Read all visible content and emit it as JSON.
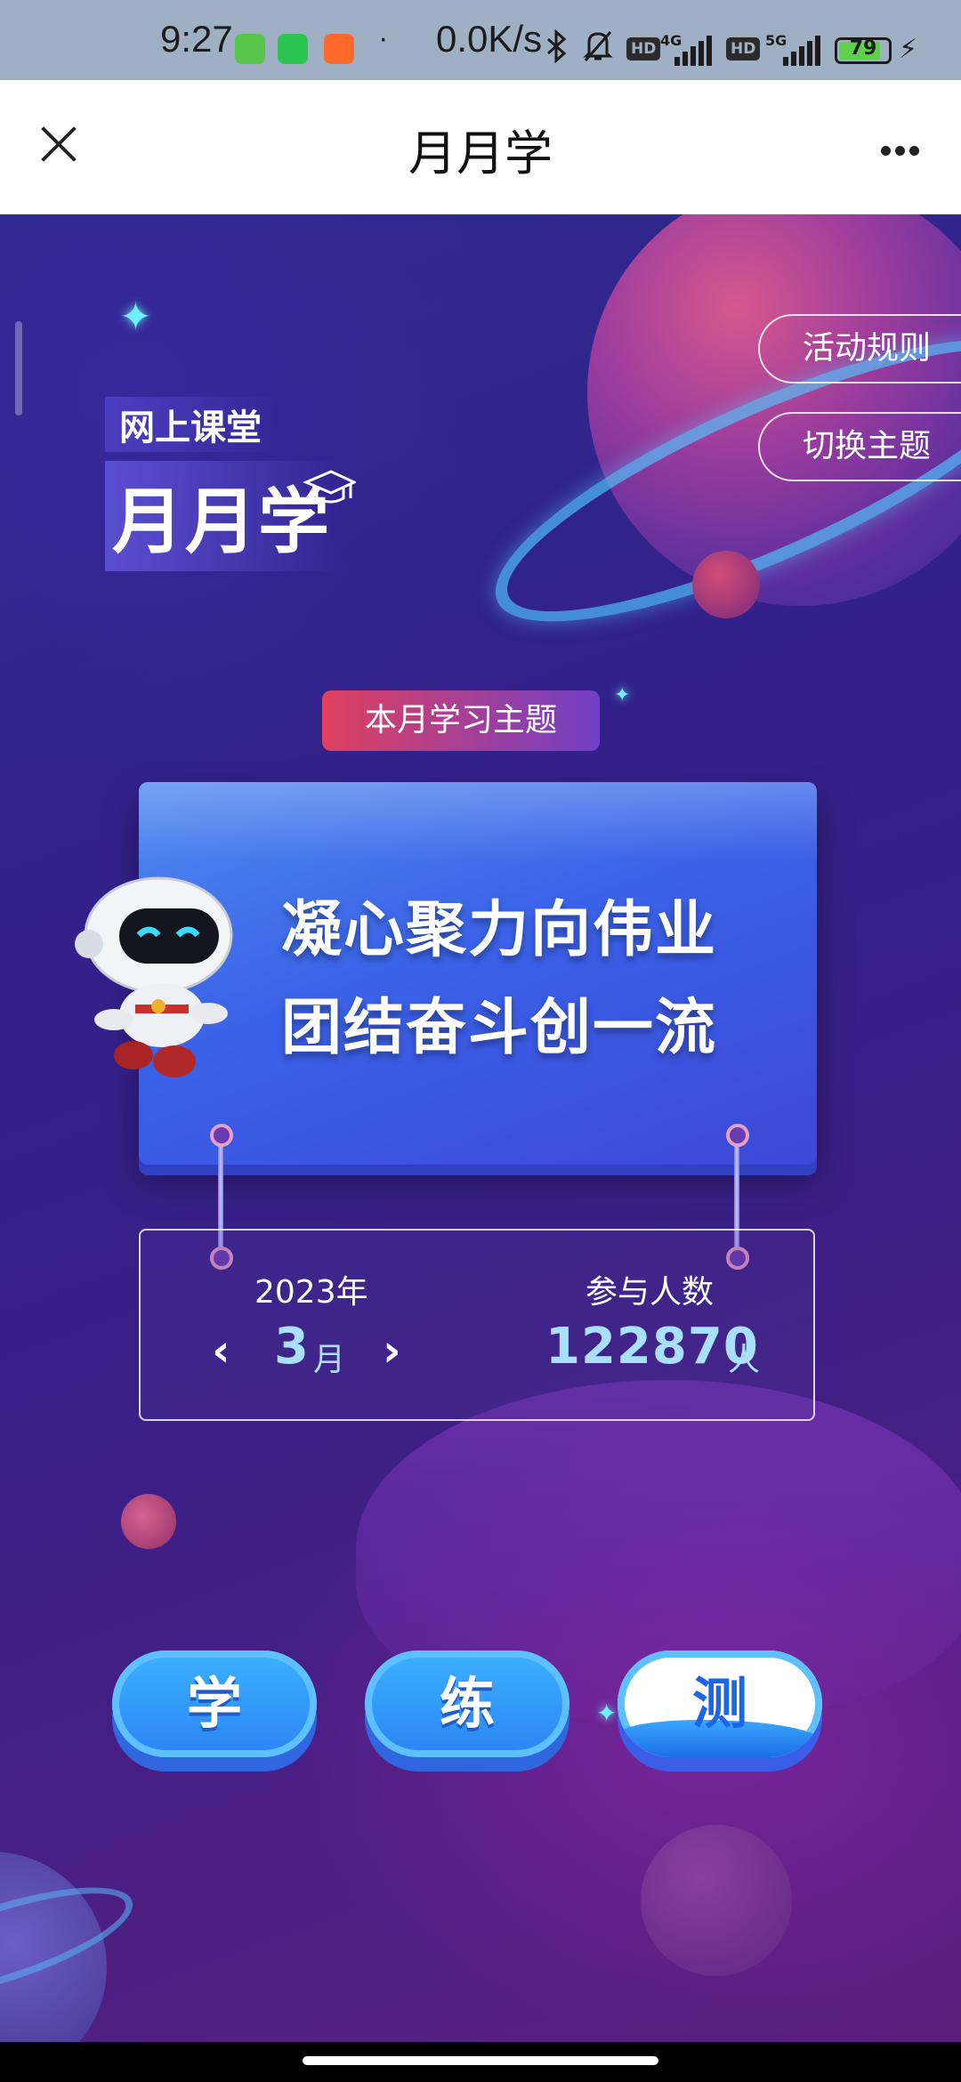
{
  "status_bar": {
    "time": "9:27",
    "dot": "·",
    "net_speed": "0.0K/s",
    "hd1": "HD",
    "net1": "4G",
    "hd2": "HD",
    "net2": "5G",
    "battery": "79",
    "battery_level": 0.79
  },
  "title_bar": {
    "title": "月月学"
  },
  "side_buttons": {
    "rules": "活动规则",
    "switch_theme": "切换主题"
  },
  "logo": {
    "top": "网上课堂",
    "main": "月月学"
  },
  "theme": {
    "tag": "本月学习主题",
    "line1": "凝心聚力向伟业",
    "line2": "团结奋斗创一流"
  },
  "info": {
    "year": "2023年",
    "month": "3",
    "month_unit": "月",
    "count_label": "参与人数",
    "count": "122870",
    "count_unit": "人"
  },
  "modes": [
    "学",
    "练",
    "测"
  ],
  "colors": {
    "accent": "#3a62e8",
    "tag_start": "#e0405e",
    "tag_end": "#7040c8",
    "highlight_text": "#a9e0ff"
  }
}
